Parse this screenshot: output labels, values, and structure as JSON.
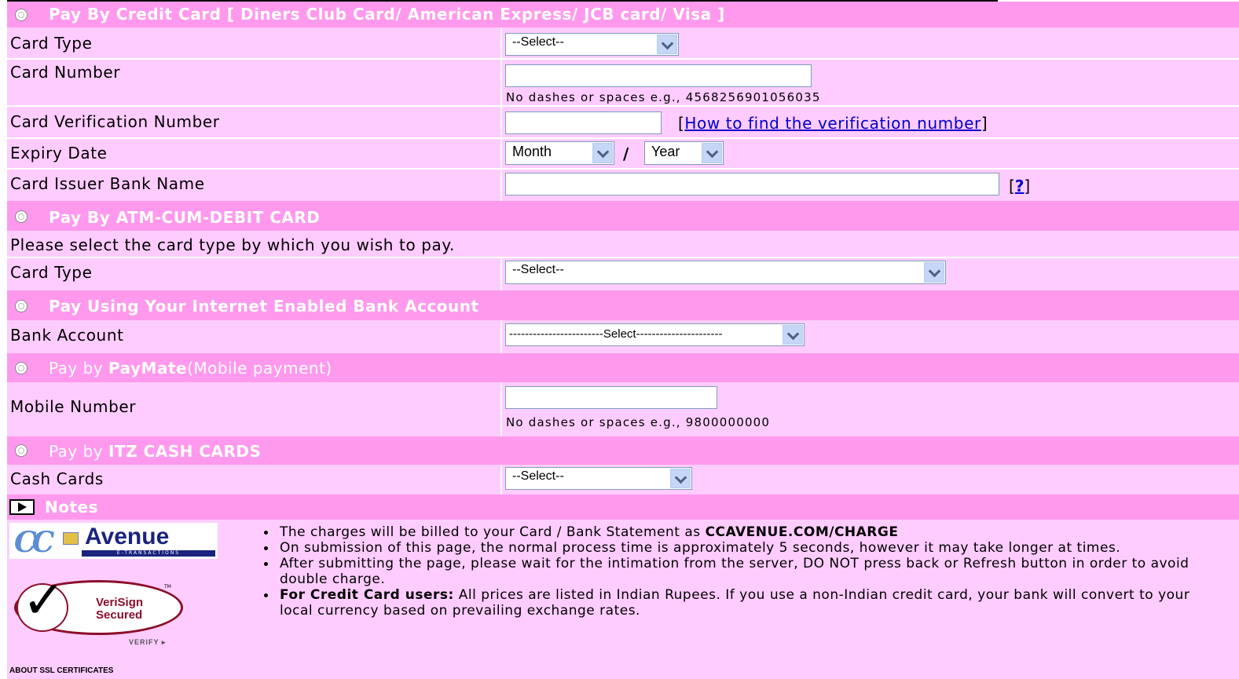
{
  "credit": {
    "header": "Pay By Credit Card [ Diners Club Card/ American Express/ JCB card/ Visa ]",
    "card_type_label": "Card Type",
    "card_type_value": "--Select--",
    "card_number_label": "Card Number",
    "card_number_hint": "No dashes or spaces e.g., 4568256901056035",
    "cvv_label": "Card Verification Number",
    "cvv_link_open": "[",
    "cvv_link": "How to find the verification number",
    "cvv_link_close": "]",
    "expiry_label": "Expiry Date",
    "month_value": "Month",
    "slash": "/",
    "year_value": "Year",
    "issuer_label": "Card Issuer Bank Name",
    "issuer_help_open": "[",
    "issuer_help": "?",
    "issuer_help_close": "]"
  },
  "atm": {
    "header": "Pay By ATM-CUM-DEBIT CARD",
    "instruction": "Please select the card type by which you wish to pay.",
    "card_type_label": "Card Type",
    "card_type_value": "--Select--"
  },
  "netbank": {
    "header": "Pay Using Your Internet Enabled Bank Account",
    "bank_label": "Bank Account",
    "bank_value": "------------------------Select----------------------"
  },
  "paymate": {
    "header_prefix": "Pay by ",
    "header_brand": "PayMate",
    "header_suffix": "(Mobile payment)",
    "mobile_label": "Mobile Number",
    "mobile_hint": "No dashes or spaces e.g., 9800000000"
  },
  "itz": {
    "header_prefix": "Pay by ",
    "header_brand": "ITZ CASH CARDS",
    "cash_label": "Cash Cards",
    "cash_value": "--Select--"
  },
  "notes": {
    "header": "Notes",
    "items": [
      {
        "bold": "",
        "text": "The charges will be billed to your Card / Bank Statement as ",
        "tail_bold": "CCAVENUE.COM/CHARGE"
      },
      {
        "bold": "",
        "text": "On submission of this page, the normal process time is approximately 5 seconds, however it may take longer at times.",
        "tail_bold": ""
      },
      {
        "bold": "",
        "text": "After submitting the page, please wait for the intimation from the server, DO NOT press back or Refresh button in order to avoid double charge.",
        "tail_bold": ""
      },
      {
        "bold": "For Credit Card users:",
        "text": " All prices are listed in Indian Rupees. If you use a non-Indian credit card, your bank will convert to your local currency based on prevailing exchange rates.",
        "tail_bold": ""
      }
    ]
  },
  "logos": {
    "ccavenue_text": "Avenue",
    "ccavenue_sub": "E-TRANSACTIONS",
    "verisign_line1": "VeriSign",
    "verisign_line2": "Secured",
    "verisign_tm": "TM",
    "verisign_verify": "VERIFY",
    "ssl_link": "ABOUT SSL CERTIFICATES"
  },
  "colors": {
    "header_bg": "#ff99ee",
    "row_bg": "#ffccff",
    "link": "#0000cc"
  }
}
